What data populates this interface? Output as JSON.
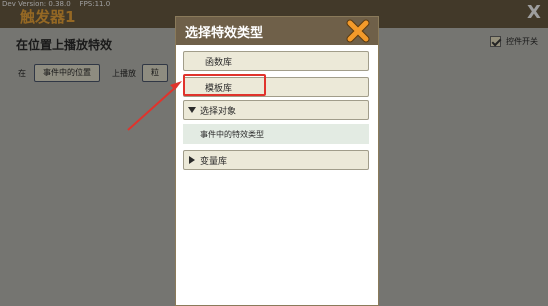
{
  "header": {
    "dev_info": "Dev Version: 0.38.0    FPS:11.0",
    "trigger_title": "触发器1",
    "close_glyph": "X"
  },
  "background": {
    "section_title": "在位置上播放特效",
    "toggle_label": "控件开关",
    "toggle_checked": true,
    "row_prefix": "在",
    "slot_position": "事件中的位置",
    "row_middle": "上播放",
    "slot_effect_partial": "粒"
  },
  "dialog": {
    "title": "选择特效类型",
    "items": [
      {
        "label": "函数库",
        "expandable": false
      },
      {
        "label": "模板库",
        "expandable": false,
        "highlighted": true
      },
      {
        "label": "选择对象",
        "expandable": true,
        "expanded": true
      },
      {
        "label": "变量库",
        "expandable": true,
        "expanded": false
      }
    ],
    "sub_items": [
      {
        "label": "事件中的特效类型"
      }
    ]
  },
  "colors": {
    "accent_orange": "#f0a93a",
    "header_brown": "#6f6049",
    "annotation_red": "#e0332c"
  },
  "icons": {
    "dialog_close": "close-x-icon",
    "expanded": "triangle-down-icon",
    "collapsed": "triangle-right-icon"
  }
}
